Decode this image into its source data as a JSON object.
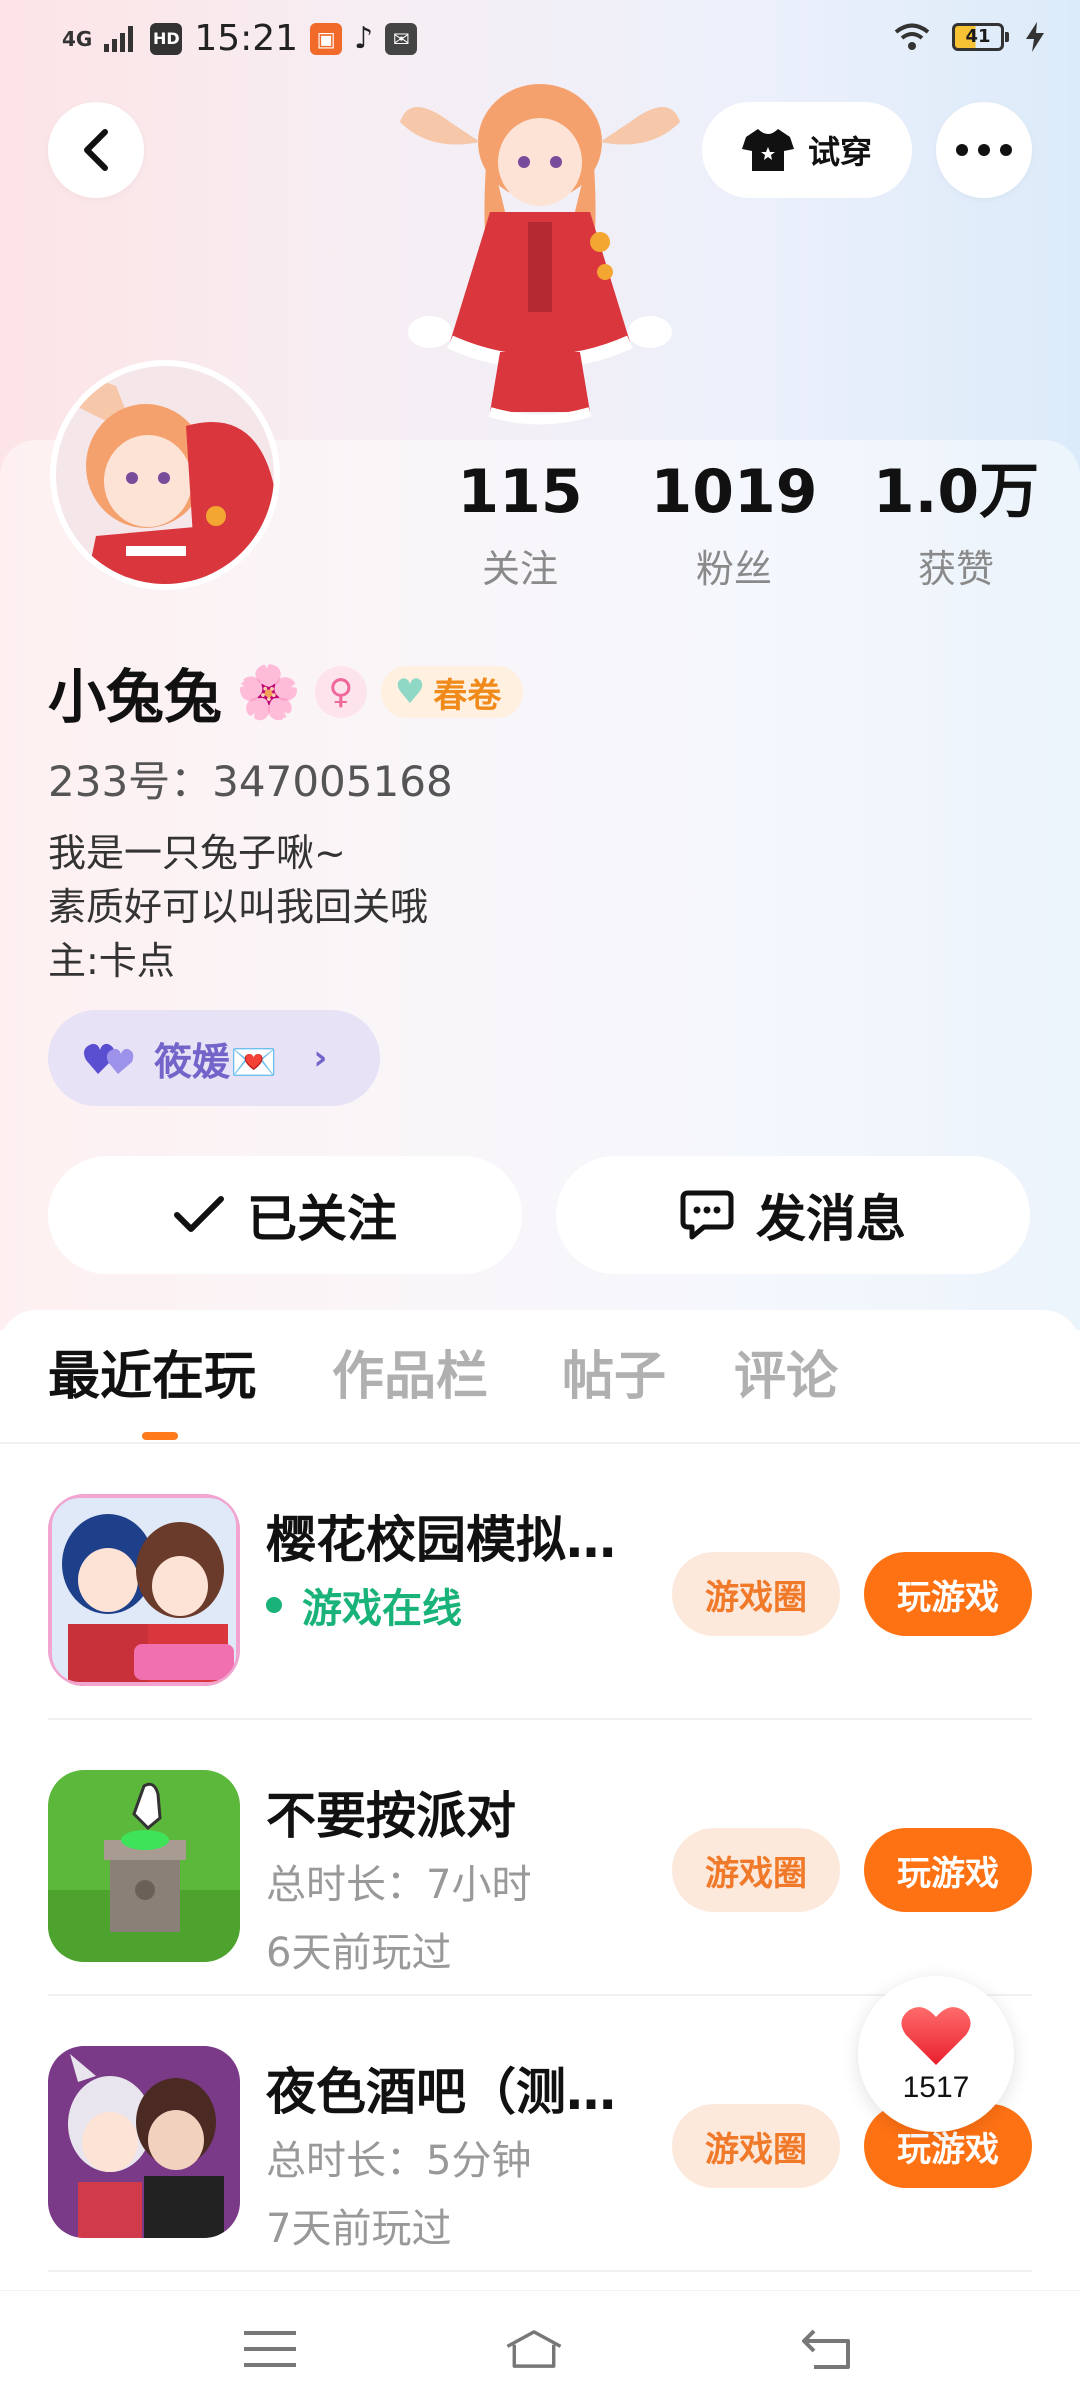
{
  "status_bar": {
    "network": "4G",
    "hd": "HD",
    "time": "15:21",
    "battery": "41"
  },
  "top_bar": {
    "try_on_label": "试穿"
  },
  "profile": {
    "stats": [
      {
        "value": "115",
        "label": "关注"
      },
      {
        "value": "1019",
        "label": "粉丝"
      },
      {
        "value": "1.0万",
        "label": "获赞"
      }
    ],
    "name": "小兔兔",
    "name_emoji": "🌸",
    "gender_symbol": "♀",
    "tag_label": "春卷",
    "uid": "233号：347005168",
    "bio_lines": [
      "我是一只兔子啾~",
      "素质好可以叫我回关哦",
      "主:卡点"
    ],
    "relation_name": "筱媛💌"
  },
  "actions": {
    "follow_label": "已关注",
    "message_label": "发消息"
  },
  "tabs": [
    "最近在玩",
    "作品栏",
    "帖子",
    "评论"
  ],
  "games": [
    {
      "title": "樱花校园模拟…",
      "sub1": "游戏在线",
      "sub2": "",
      "online": true
    },
    {
      "title": "不要按派对",
      "sub1": "总时长：7小时",
      "sub2": "6天前玩过",
      "online": false
    },
    {
      "title": "夜色酒吧（测…",
      "sub1": "总时长：5分钟",
      "sub2": "7天前玩过",
      "online": false
    }
  ],
  "game_buttons": {
    "circle_label": "游戏圈",
    "play_label": "玩游戏"
  },
  "float_like": {
    "count": "1517"
  },
  "colors": {
    "accent_orange": "#ff7214",
    "online_green": "#19b37a",
    "relation_purple": "#7264c8"
  }
}
